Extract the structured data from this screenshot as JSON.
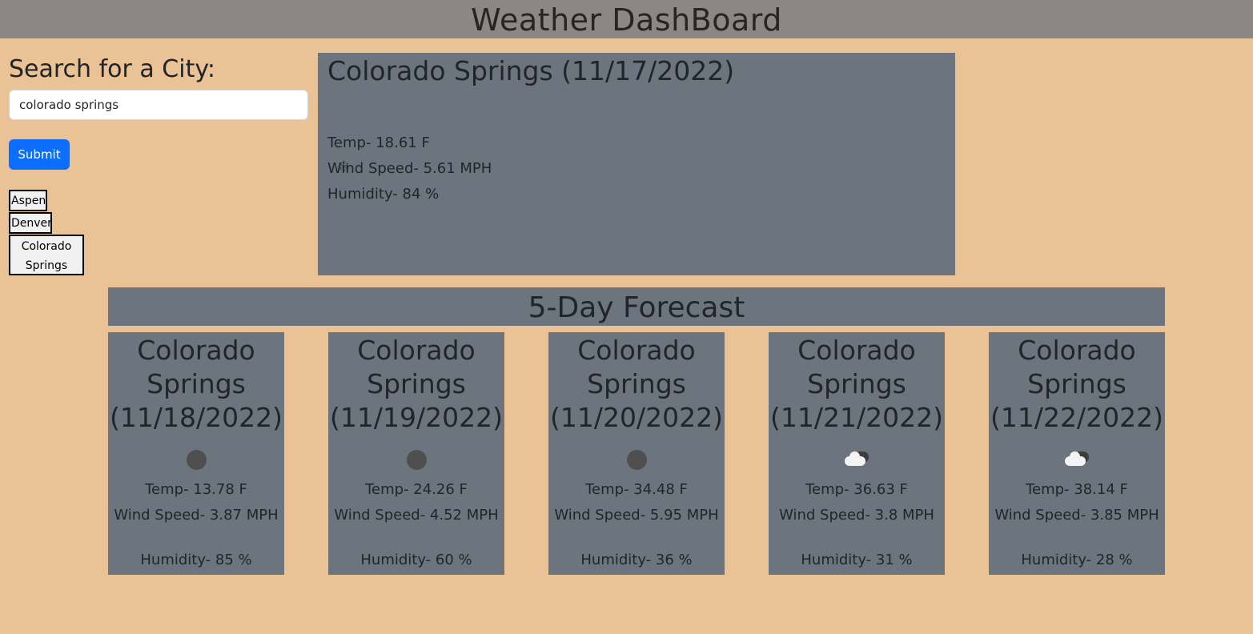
{
  "header": {
    "title": "Weather DashBoard"
  },
  "search": {
    "title": "Search for a City:",
    "input_value": "colorado springs",
    "submit_label": "Submit"
  },
  "history": [
    "Aspen",
    "Denver",
    "Colorado Springs"
  ],
  "current": {
    "title": "Colorado Springs (11/17/2022)",
    "icon": "snowflake-icon",
    "temp": "Temp- 18.61 F",
    "wind": "Wind Speed- 5.61 MPH",
    "humidity": "Humidity- 84 %"
  },
  "forecast": {
    "title": "5-Day Forecast",
    "days": [
      {
        "title": "Colorado Springs (11/18/2022)",
        "icon": "moon-icon",
        "temp": "Temp- 13.78 F",
        "wind": "Wind Speed- 3.87 MPH",
        "humidity": "Humidity- 85 %"
      },
      {
        "title": "Colorado Springs (11/19/2022)",
        "icon": "moon-icon",
        "temp": "Temp- 24.26 F",
        "wind": "Wind Speed- 4.52 MPH",
        "humidity": "Humidity- 60 %"
      },
      {
        "title": "Colorado Springs (11/20/2022)",
        "icon": "moon-icon",
        "temp": "Temp- 34.48 F",
        "wind": "Wind Speed- 5.95 MPH",
        "humidity": "Humidity- 36 %"
      },
      {
        "title": "Colorado Springs (11/21/2022)",
        "icon": "cloud-icon",
        "temp": "Temp- 36.63 F",
        "wind": "Wind Speed- 3.8 MPH",
        "humidity": "Humidity- 31 %"
      },
      {
        "title": "Colorado Springs (11/22/2022)",
        "icon": "cloud-icon",
        "temp": "Temp- 38.14 F",
        "wind": "Wind Speed- 3.85 MPH",
        "humidity": "Humidity- 28 %"
      }
    ]
  },
  "colors": {
    "page_bg": "#e9c295",
    "header_bg": "#8c8685",
    "card_bg": "#6c757d",
    "submit_bg": "#0d6efd"
  }
}
